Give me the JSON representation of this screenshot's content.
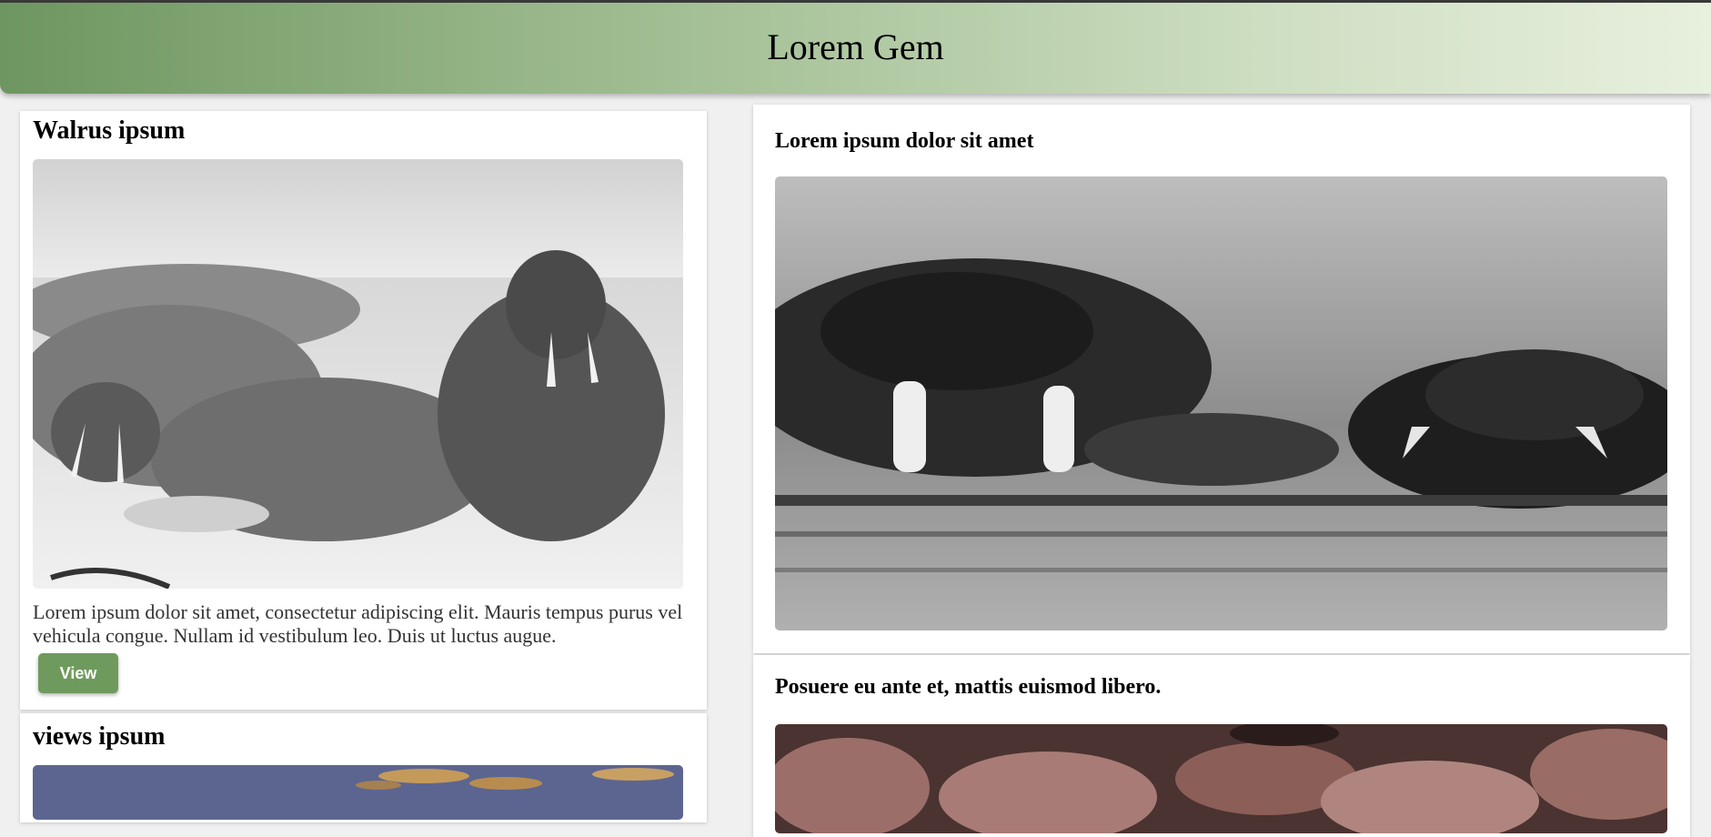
{
  "header": {
    "title": "Lorem Gem"
  },
  "left_cards": [
    {
      "title": "Walrus ipsum",
      "image": "walrus-group-on-sand-photo",
      "description": "Lorem ipsum dolor sit amet, consectetur adipiscing elit. Mauris tempus purus vel vehicula congue. Nullam id vestibulum leo. Duis ut luctus augue.",
      "button_label": "View"
    },
    {
      "title": "views ipsum",
      "image": "sky-clouds-photo"
    }
  ],
  "right_cards": [
    {
      "title": "Lorem ipsum dolor sit amet",
      "image": "walruses-swimming-photo"
    },
    {
      "title": "Posuere eu ante et, mattis euismod libero.",
      "image": "walrus-herd-closeup-photo"
    }
  ],
  "colors": {
    "header_gradient_start": "#6e9660",
    "header_gradient_end": "#e8f0de",
    "button": "#6f9a5d",
    "page_background": "#f0f0f0"
  }
}
